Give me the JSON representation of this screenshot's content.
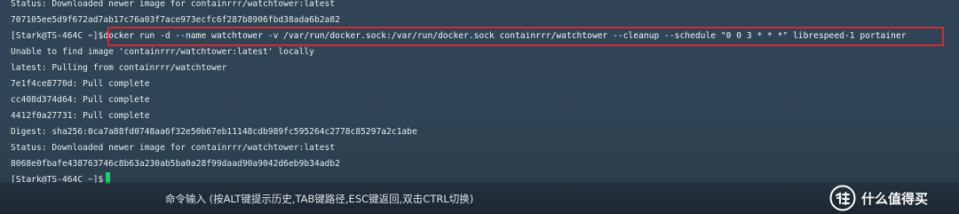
{
  "terminal": {
    "lines": [
      "Status: Downloaded newer image for containrrr/watchtower:latest",
      "707105ee5d9f672ad7ab17c76a03f7ace973ecfc6f287b8906fbd38ada6b2a82"
    ],
    "prompt_1": "[Stark@TS-464C ~]$",
    "command": "docker run -d --name watchtower -v /var/run/docker.sock:/var/run/docker.sock containrrr/watchtower --cleanup --schedule \"0 0 3 * * *\" librespeed-1 portainer",
    "output": [
      "Unable to find image 'containrrr/watchtower:latest' locally",
      "latest: Pulling from containrrr/watchtower",
      "7e1f4ce8770d: Pull complete",
      "cc408d374d64: Pull complete",
      "4412f0a27731: Pull complete",
      "Digest: sha256:0ca7a88fd0748aa6f32e50b67eb11148cdb989fc595264c2778c85297a2c1abe",
      "Status: Downloaded newer image for containrrr/watchtower:latest",
      "8068e0fbafe438763746c8b63a230ab5ba0a28f99daad90a9042d6eb9b34adb2"
    ],
    "prompt_2": "[Stark@TS-464C ~]$"
  },
  "input_bar": {
    "hint": "命令输入 (按ALT键提示历史,TAB键路径,ESC键返回,双击CTRL切换)"
  },
  "watermark": {
    "text": "什么值得买",
    "icon": "smzdm-logo-icon"
  },
  "colors": {
    "background": "#2f4354",
    "cursor": "#16d16a",
    "highlight_border": "#e2262d"
  }
}
